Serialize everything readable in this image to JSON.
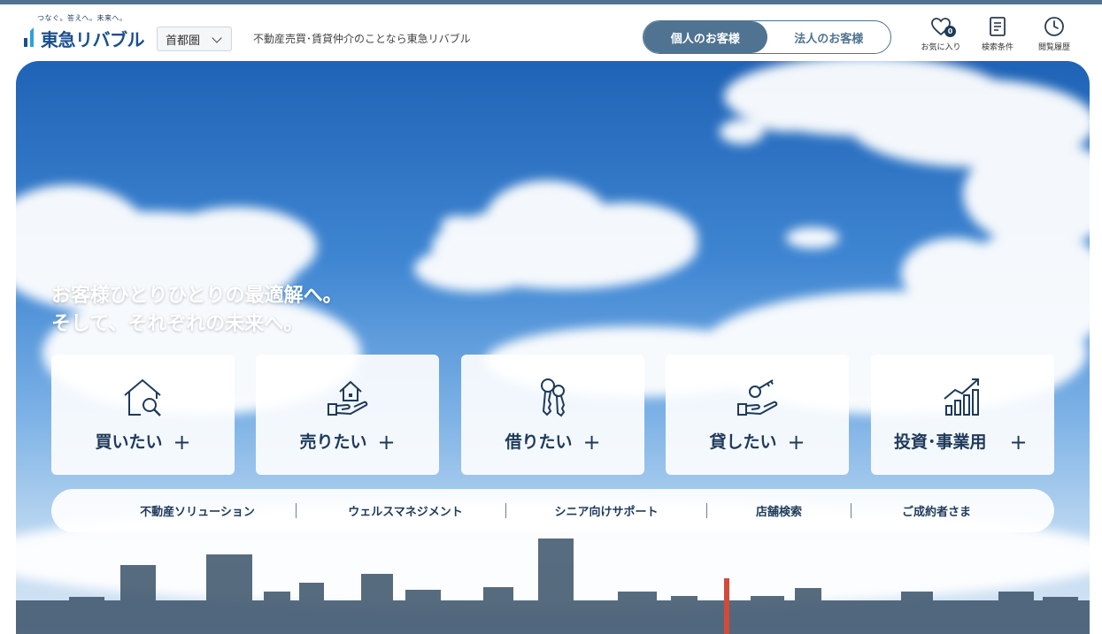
{
  "brand": {
    "tagline": "つなぐ。答えへ。未来へ。",
    "name": "東急リバブル",
    "color": "#1b4f8c"
  },
  "header": {
    "region": "首都圏",
    "description": "不動産売買･賃貸仲介のことなら東急リバブル",
    "toggle": {
      "personal": "個人のお客様",
      "business": "法人のお客様",
      "active": "personal"
    },
    "favorites": {
      "label": "お気に入り",
      "count": "0",
      "icon": "heart-icon"
    },
    "search_conditions": {
      "label": "検索条件",
      "icon": "document-icon"
    },
    "history": {
      "label": "閲覧履歴",
      "icon": "clock-icon"
    }
  },
  "hero": {
    "line1": "お客様ひとりひとりの最適解へ。",
    "line2": "そして、それぞれの未来へ。"
  },
  "cards": [
    {
      "label": "買いたい",
      "icon": "house-search-icon"
    },
    {
      "label": "売りたい",
      "icon": "hand-house-icon"
    },
    {
      "label": "借りたい",
      "icon": "keys-icon"
    },
    {
      "label": "貸したい",
      "icon": "hand-key-icon"
    },
    {
      "label": "投資･事業用",
      "icon": "bar-chart-icon"
    }
  ],
  "subnav": [
    "不動産ソリューション",
    "ウェルスマネジメント",
    "シニア向けサポート",
    "店舗検索",
    "ご成約者さま"
  ],
  "colors": {
    "accent": "#4f7391",
    "navy": "#1e3a5a"
  }
}
